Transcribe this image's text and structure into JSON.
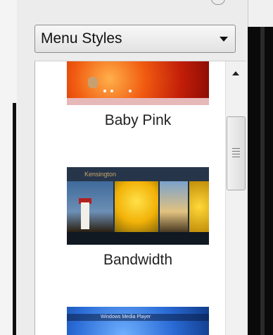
{
  "menu_styles_dropdown": {
    "selected": "Menu Styles"
  },
  "styles_list": {
    "items": [
      {
        "name": "Baby Pink",
        "thumbnail_text": ""
      },
      {
        "name": "Bandwidth",
        "thumbnail_text": "Kensington"
      },
      {
        "name": "",
        "thumbnail_text": "Windows Media Player"
      }
    ]
  },
  "icons": {
    "dropdown": "chevron-down-icon",
    "scroll_up": "scroll-up-arrow-icon",
    "scroll_grip": "grip-icon"
  },
  "colors": {
    "pane_background": "#ffffff",
    "chrome_background": "#ececec",
    "text": "#222222"
  }
}
